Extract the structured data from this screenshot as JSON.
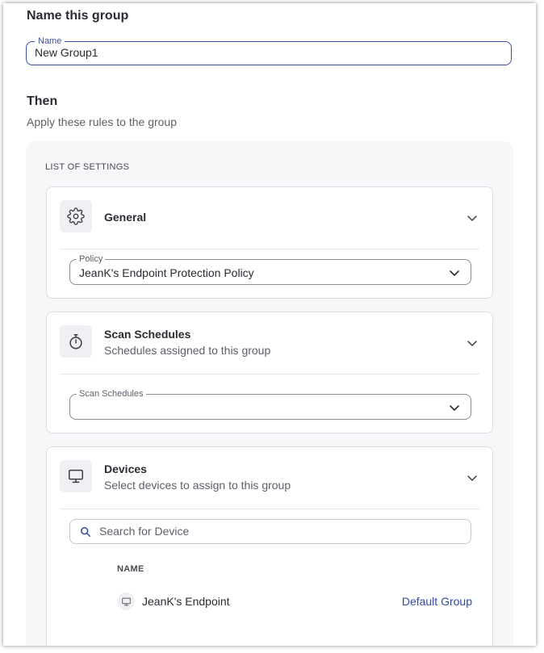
{
  "name_section": {
    "title": "Name this group",
    "field_label": "Name",
    "field_value": "New Group1"
  },
  "then_section": {
    "title": "Then",
    "subtitle": "Apply these rules to the group"
  },
  "settings": {
    "list_label": "LIST OF SETTINGS",
    "general": {
      "title": "General",
      "icon": "gear-icon",
      "policy_label": "Policy",
      "policy_value": "JeanK's Endpoint Protection Policy"
    },
    "scan_schedules": {
      "title": "Scan Schedules",
      "subtitle": "Schedules assigned to this group",
      "icon": "stopwatch-icon",
      "field_label": "Scan Schedules",
      "field_value": ""
    },
    "devices": {
      "title": "Devices",
      "subtitle": "Select devices to assign to this group",
      "icon": "monitor-icon",
      "search_placeholder": "Search for Device",
      "column_header": "NAME",
      "rows": [
        {
          "name": "JeanK's Endpoint",
          "group": "Default Group"
        }
      ]
    }
  },
  "colors": {
    "accent": "#3b4f9e",
    "link": "#2f4aa8",
    "panel_bg": "#f6f7f9"
  }
}
